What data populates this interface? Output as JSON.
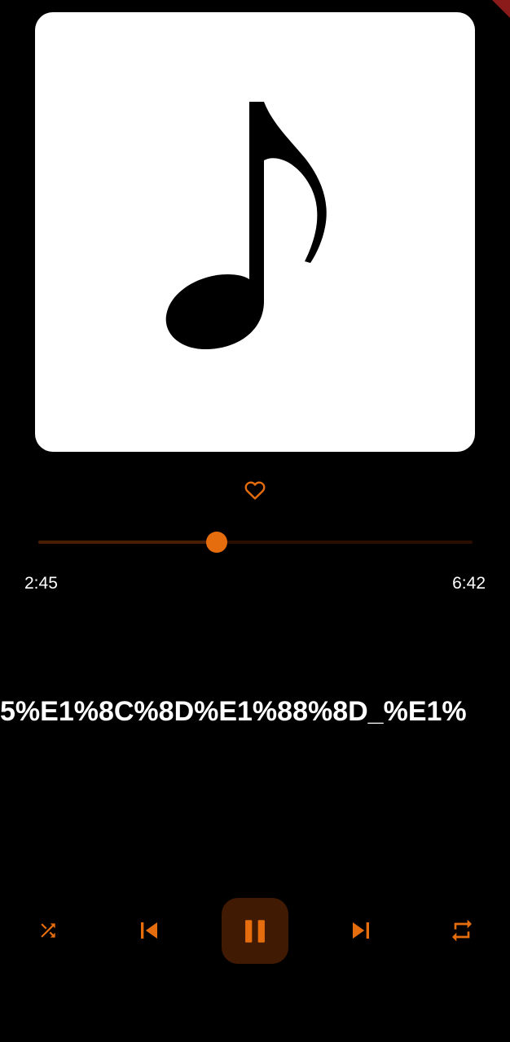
{
  "colors": {
    "background": "#000000",
    "accent": "#e66d0d",
    "artwork_background": "#ffffff",
    "play_button_background": "#401a02"
  },
  "artwork": {
    "icon": "music-note-icon"
  },
  "favorite": {
    "icon": "heart-outline-icon",
    "active": false
  },
  "progress": {
    "elapsed": "2:45",
    "total": "6:42",
    "fraction": 0.41
  },
  "track": {
    "title": "5%E1%8C%8D%E1%88%8D_%E1%"
  },
  "controls": {
    "shuffle": {
      "icon": "shuffle-icon"
    },
    "previous": {
      "icon": "skip-previous-icon"
    },
    "play_pause": {
      "icon": "pause-icon",
      "state": "playing"
    },
    "next": {
      "icon": "skip-next-icon"
    },
    "repeat": {
      "icon": "repeat-icon"
    }
  }
}
